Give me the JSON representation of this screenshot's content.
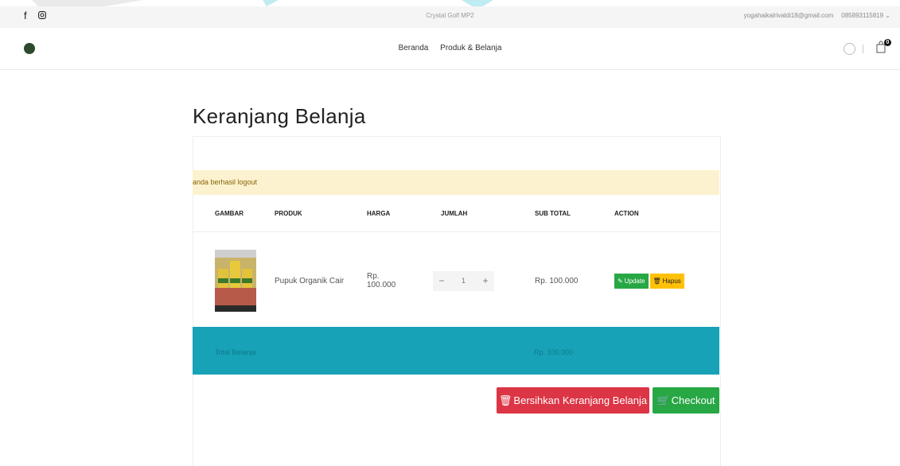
{
  "topbar": {
    "shop_name": "Crystal Golf MP2",
    "email": "yogahaikalrivaldi18@gmail.com",
    "phone": "085893115819 ⌄",
    "social": [
      "facebook-icon",
      "instagram-icon"
    ]
  },
  "header": {
    "nav": [
      "Beranda",
      "Produk & Belanja"
    ],
    "cart_count": "0"
  },
  "page": {
    "title": "Keranjang Belanja"
  },
  "alert": {
    "message": "anda berhasil logout"
  },
  "table": {
    "headers": [
      "GAMBAR",
      "PRODUK",
      "HARGA",
      "JUMLAH",
      "SUB TOTAL",
      "ACTION"
    ],
    "rows": [
      {
        "product": "Pupuk Organik Cair",
        "price_line1": "Rp.",
        "price_line2": "100.000",
        "qty_minus": "−",
        "qty": "1",
        "qty_plus": "+",
        "subtotal": "Rp. 100.000",
        "update_label": "Update",
        "hapus_label": "Hapus"
      }
    ]
  },
  "total": {
    "label": "Total Belanja",
    "amount": "Rp. 100.000"
  },
  "actions": {
    "clear_label": "Bersihkan Keranjang Belanja",
    "checkout_label": "Checkout"
  },
  "colors": {
    "alert_bg": "#fdf2cf",
    "total_bg": "#17a2b8",
    "danger": "#dc3545",
    "success": "#28a745",
    "warning": "#ffc107"
  }
}
